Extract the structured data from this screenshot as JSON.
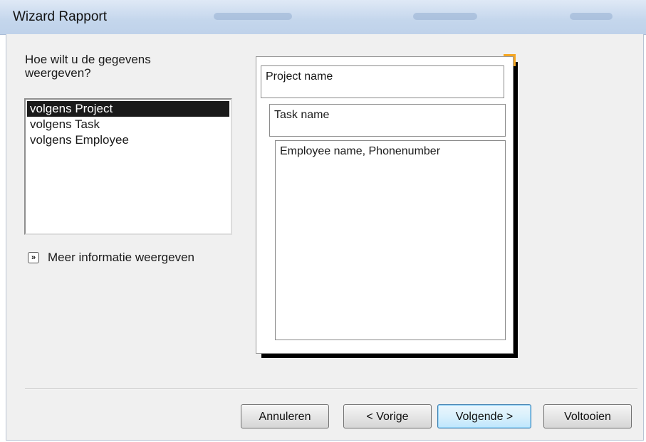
{
  "window": {
    "title": "Wizard Rapport"
  },
  "prompt": {
    "question": "Hoe wilt u de gegevens\nweergeven?"
  },
  "view_list": {
    "items": [
      {
        "label": "volgens Project",
        "selected": true
      },
      {
        "label": "volgens Task",
        "selected": false
      },
      {
        "label": "volgens Employee",
        "selected": false
      }
    ]
  },
  "more_info": {
    "icon": "double-chevron-right-icon",
    "label": "Meer informatie weergeven"
  },
  "preview": {
    "level1": "Project name",
    "level2": "Task name",
    "detail": "Employee name, Phonenumber"
  },
  "buttons": {
    "cancel": "Annuleren",
    "previous": "< Vorige",
    "next": "Volgende >",
    "finish": "Voltooien"
  },
  "colors": {
    "selection_bg": "#1a1a1a",
    "accent_corner": "#f5a623",
    "primary_button_border": "#3c7fb1"
  }
}
